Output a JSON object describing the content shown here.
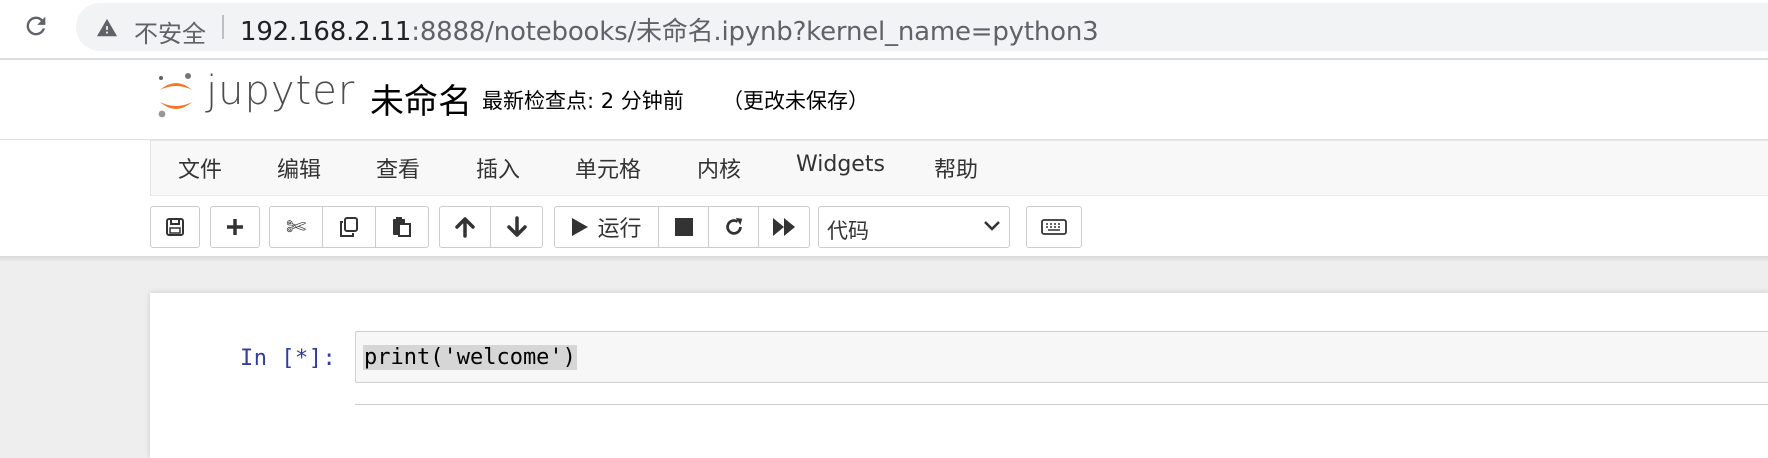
{
  "browser": {
    "security_label": "不安全",
    "url_host": "192.168.2.11",
    "url_rest": ":8888/notebooks/未命名.ipynb?kernel_name=python3"
  },
  "header": {
    "logo_text": "jupyter",
    "notebook_name": "未命名",
    "checkpoint": "最新检查点: 2 分钟前",
    "unsaved": "（更改未保存）"
  },
  "menu": {
    "items": [
      "文件",
      "编辑",
      "查看",
      "插入",
      "单元格",
      "内核",
      "Widgets",
      "帮助"
    ]
  },
  "toolbar": {
    "run_label": "运行",
    "cell_type": "代码"
  },
  "cell": {
    "prompt": "In [*]:",
    "code": "print('welcome')"
  },
  "colors": {
    "jupyter_orange": "#f37726",
    "prompt_blue": "#303f9f"
  }
}
